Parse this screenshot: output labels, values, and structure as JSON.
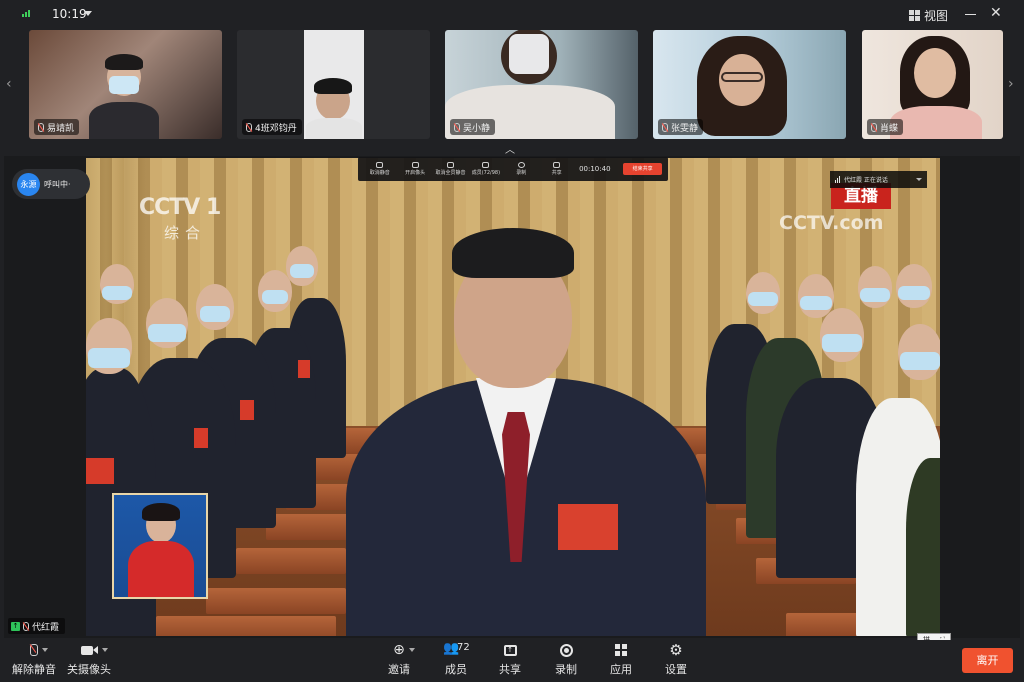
{
  "titlebar": {
    "time": "10:19",
    "view_label": "视图"
  },
  "participants": [
    {
      "name": "易靖凯"
    },
    {
      "name": "4班邓钧丹"
    },
    {
      "name": "吴小静"
    },
    {
      "name": "张雯静"
    },
    {
      "name": "肖蝶"
    }
  ],
  "caller": {
    "avatar_text": "永源",
    "label": "呼叫中·"
  },
  "share_bar": {
    "items": [
      "取消静音",
      "开启像头",
      "取消全员静音",
      "成员(72/98)",
      "录制",
      "共享"
    ],
    "elapsed": "00:10:40",
    "stop_label": "结束共享"
  },
  "speaking": {
    "label": "代红霞 正在说话"
  },
  "broadcast": {
    "channel_logo": "CCTV 1",
    "channel_name": "综合",
    "live_label": "直播",
    "watermark": "CCTV.com"
  },
  "self": {
    "name": "代红霞"
  },
  "mini_control": "拼",
  "toolbar": {
    "unmute": "解除静音",
    "camera": "关摄像头",
    "invite": "邀请",
    "members": "成员",
    "members_count": "72",
    "share": "共享",
    "record": "录制",
    "apps": "应用",
    "settings": "设置",
    "leave": "离开"
  },
  "colors": {
    "accent_blue": "#2a86f0",
    "leave_red": "#f0522f",
    "signal_green": "#3ecf5a"
  }
}
